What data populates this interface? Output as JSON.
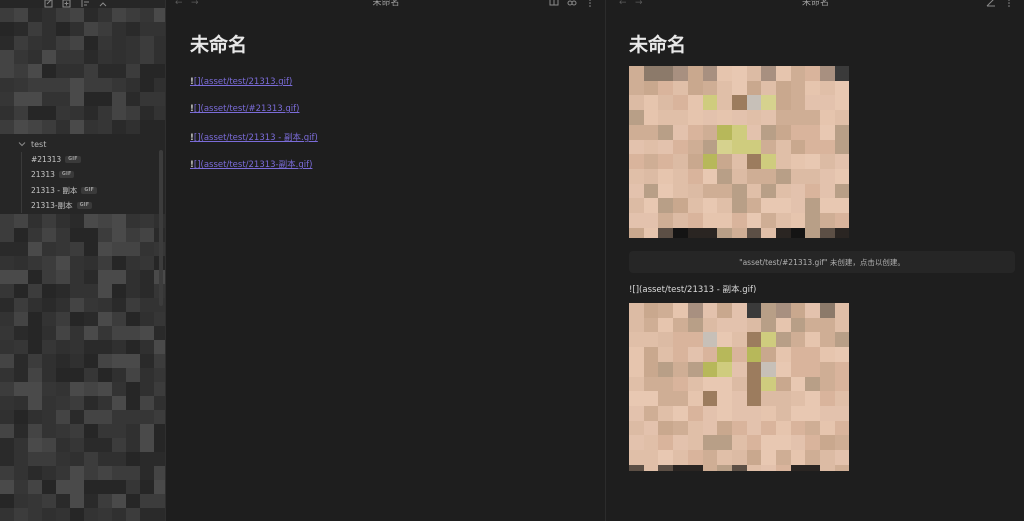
{
  "sidebar": {
    "folder": "test",
    "files": [
      {
        "name": "#21313",
        "badge": "GIF"
      },
      {
        "name": "21313",
        "badge": "GIF"
      },
      {
        "name": "21313 - 副本",
        "badge": "GIF"
      },
      {
        "name": "21313-副本",
        "badge": "GIF"
      }
    ]
  },
  "left_pane": {
    "tab_title": "未命名",
    "title": "未命名",
    "lines": [
      {
        "prefix": "!",
        "link": "[](asset/test/21313.gif)"
      },
      {
        "prefix": "!",
        "link": "[](asset/test/#21313.gif)"
      },
      {
        "prefix": "!",
        "link": "[](asset/test/21313 - 副本.gif)"
      },
      {
        "prefix": "!",
        "link": "[](asset/test/21313-副本.gif)"
      }
    ]
  },
  "right_pane": {
    "tab_title": "未命名",
    "title": "未命名",
    "notice": "\"asset/test/#21313.gif\" 未创建，点击以创建。",
    "raw_line": "![](asset/test/21313 - 副本.gif)"
  },
  "colors": {
    "background": "#1e1e1e",
    "sidebar": "#262626",
    "link": "#7b6cd9"
  }
}
